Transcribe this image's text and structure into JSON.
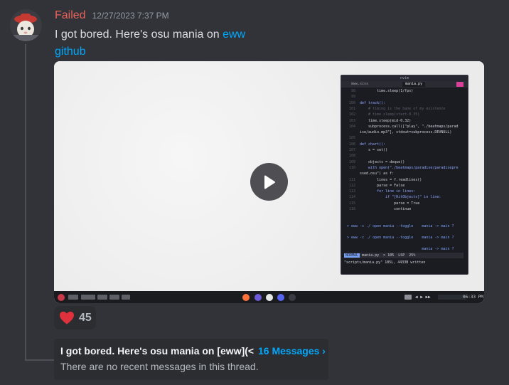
{
  "message": {
    "username": "Failed",
    "timestamp": "12/27/2023 7:37 PM",
    "text": "I got bored. Here's osu mania on ",
    "link1": "eww",
    "link2": "github",
    "username_color": "#e9625a",
    "link_color": "#00a8fc"
  },
  "video": {
    "terminal": {
      "title": "nvim",
      "tab1": "mww.scss",
      "tab2": "mania.py",
      "code": [
        {
          "n": "98",
          "t": "        time.sleep(1/fps)"
        },
        {
          "n": "99",
          "t": ""
        },
        {
          "n": "100",
          "t": "def track():"
        },
        {
          "n": "101",
          "t": "    # timing is the bane of my existence"
        },
        {
          "n": "102",
          "t": "    # time.sleep(start-0.35)"
        },
        {
          "n": "103",
          "t": "    time.sleep(mid-0.32)"
        },
        {
          "n": "104",
          "t": "    subprocess.call([\"play\", \"./beatmaps/parad"
        },
        {
          "n": "",
          "t": "ise/audio.mp3\"], stdout=subprocess.DEVNULL)"
        },
        {
          "n": "105",
          "t": ""
        },
        {
          "n": "106",
          "t": "def chart():"
        },
        {
          "n": "107",
          "t": "    s = set()"
        },
        {
          "n": "108",
          "t": ""
        },
        {
          "n": "109",
          "t": "    objects = deque()"
        },
        {
          "n": "110",
          "t": "    with open(\"./beatmaps/paradise/paradisepre"
        },
        {
          "n": "",
          "t": "ssed.osu\") as f:"
        },
        {
          "n": "111",
          "t": "        lines = f.readlines()"
        },
        {
          "n": "112",
          "t": "        parse = False"
        },
        {
          "n": "113",
          "t": "        for line in lines:"
        },
        {
          "n": "114",
          "t": "            if \"[HitObjects]\" in line:"
        },
        {
          "n": "115",
          "t": "                parse = True"
        },
        {
          "n": "116",
          "t": "                continue"
        }
      ],
      "prompt1": "> eww -c ./ open mania --toggle    mania -> main ?",
      "prompt2": "> eww -c ./ open mania --toggle    mania -> main ?",
      "prompt3": "                                   mania -> main ?",
      "status_mode": "NORMAL",
      "status_rest": " mania.py  > 105  LSP  25%",
      "status_file": "\"scripts/mania.py\" 185L, 4433B written"
    },
    "taskbar_clock": "06:33 PM"
  },
  "reaction": {
    "emoji": "heart-icon",
    "count": "45",
    "heart_color": "#e0313d"
  },
  "thread": {
    "title": "I got bored. Here's osu mania on [eww](<",
    "count": "16 Messages ›",
    "empty": "There are no recent messages in this thread."
  }
}
